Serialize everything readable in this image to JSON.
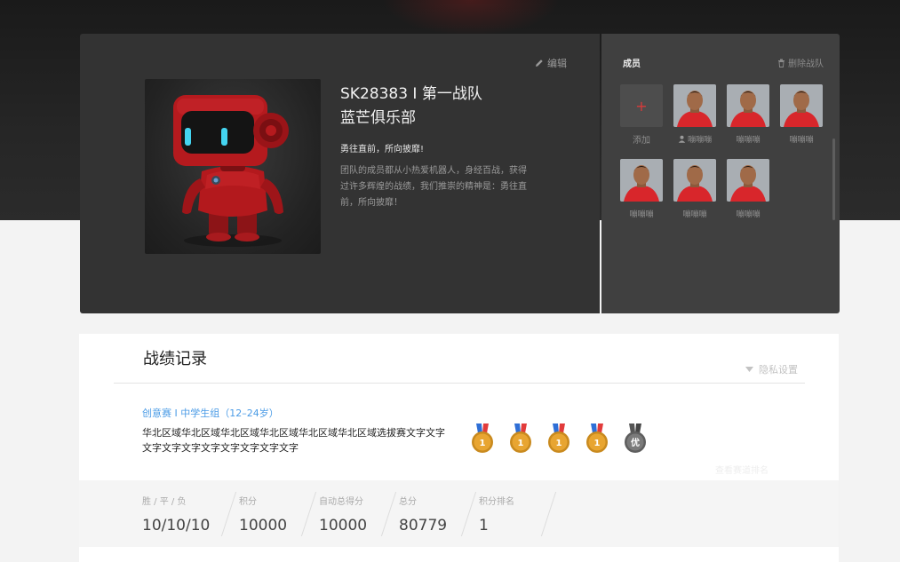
{
  "team": {
    "edit_label": "编辑",
    "name_line1": "SK28383 I 第一战队",
    "name_line2": "蓝芒俱乐部",
    "slogan": "勇往直前，所向披靡!",
    "description": "团队的成员都从小热爱机器人，身经百战，获得过许多辉煌的战绩，我们推崇的精神是：勇往直前，所向披靡！"
  },
  "members": {
    "title": "成员",
    "disband_label": "删除战队",
    "add_label": "添加",
    "list": [
      {
        "name": "嘣嘣嘣",
        "is_leader": true
      },
      {
        "name": "嘣嘣嘣",
        "is_leader": false
      },
      {
        "name": "嘣嘣嘣",
        "is_leader": false
      },
      {
        "name": "嘣嘣嘣",
        "is_leader": false
      },
      {
        "name": "嘣嘣嘣",
        "is_leader": false
      },
      {
        "name": "嘣嘣嘣",
        "is_leader": false
      }
    ]
  },
  "record": {
    "title": "战绩记录",
    "privacy_label": "隐私设置",
    "match_title": "创意赛 I 中学生组（12–24岁）",
    "match_region": "华北区域华北区域华北区域华北区域华北区域华北区域选拔赛文字文字文字文字文字文字文字文字文字文字",
    "faint_text": "查看赛道排名",
    "medals": [
      {
        "label": "1",
        "type": "gold"
      },
      {
        "label": "1",
        "type": "gold"
      },
      {
        "label": "1",
        "type": "gold"
      },
      {
        "label": "1",
        "type": "gold"
      },
      {
        "label": "优",
        "type": "gray"
      }
    ],
    "stats": [
      {
        "label": "胜 / 平 / 负",
        "value": "10/10/10"
      },
      {
        "label": "积分",
        "value": "10000"
      },
      {
        "label": "自动总得分",
        "value": "10000"
      },
      {
        "label": "总分",
        "value": "80779"
      },
      {
        "label": "积分排名",
        "value": "1"
      }
    ]
  },
  "colors": {
    "accent_blue": "#4a9be6",
    "accent_red": "#d83a3a",
    "medal_gold": "#e8a531",
    "medal_gray": "#7a7a7a"
  }
}
